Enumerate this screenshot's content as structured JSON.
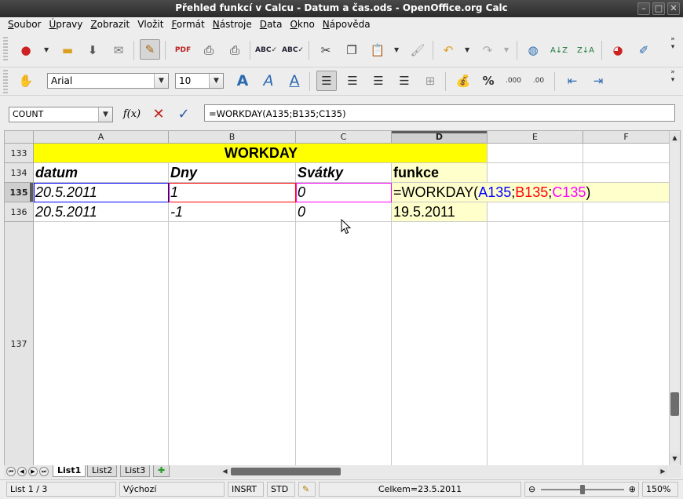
{
  "window": {
    "title": "Přehled funkcí v Calcu - Datum a čas.ods - OpenOffice.org Calc"
  },
  "menu": [
    {
      "label": "Soubor",
      "acc": "S",
      "rest": "oubor"
    },
    {
      "label": "Úpravy",
      "acc": "Ú",
      "rest": "pravy"
    },
    {
      "label": "Zobrazit",
      "acc": "Z",
      "rest": "obrazit"
    },
    {
      "label": "Vložit",
      "acc": "V",
      "rest": "ložit",
      "pre": ""
    },
    {
      "label": "Formát",
      "acc": "F",
      "rest": "ormát"
    },
    {
      "label": "Nástroje",
      "acc": "N",
      "rest": "ástroje"
    },
    {
      "label": "Data",
      "acc": "D",
      "rest": "ata"
    },
    {
      "label": "Okno",
      "acc": "O",
      "rest": "kno"
    },
    {
      "label": "Nápověda",
      "acc": "N",
      "rest": "ápověda"
    }
  ],
  "format_toolbar": {
    "font_name": "Arial",
    "font_size": "10"
  },
  "formula_bar": {
    "name_box": "COUNT",
    "fx_label": "f(x)",
    "formula": "=WORKDAY(A135;B135;C135)"
  },
  "columns": [
    "A",
    "B",
    "C",
    "D",
    "E",
    "F"
  ],
  "rows": [
    "133",
    "134",
    "135",
    "136",
    "137"
  ],
  "cells": {
    "title": "WORKDAY",
    "h_datum": "datum",
    "h_dny": "Dny",
    "h_svatky": "Svátky",
    "h_funkce": "funkce",
    "r135_a": "20.5.2011",
    "r135_b": "1",
    "r135_c": "0",
    "r135_d_pre": "=WORKDAY(",
    "r135_d_a": "A135",
    "r135_d_s1": ";",
    "r135_d_b": "B135",
    "r135_d_s2": ";",
    "r135_d_c": "C135",
    "r135_d_post": ")",
    "r136_a": "20.5.2011",
    "r136_b": "-1",
    "r136_c": "0",
    "r136_d": "19.5.2011"
  },
  "ref_colors": {
    "a": "#0000ff",
    "b": "#ff0000",
    "c": "#ff00ff"
  },
  "sheets": [
    "List1",
    "List2",
    "List3"
  ],
  "status": {
    "sheet": "List 1 / 3",
    "style": "Výchozí",
    "mode": "INSRT",
    "sel": "STD",
    "sum": "Celkem=23.5.2011",
    "zoom": "150%",
    "zoom_level": 0.5
  }
}
